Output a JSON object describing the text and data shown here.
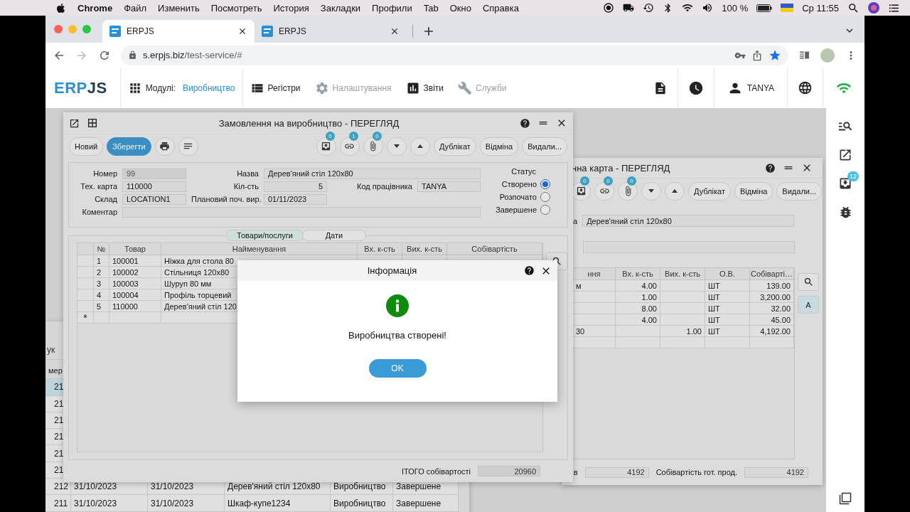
{
  "menubar": {
    "app": "Chrome",
    "menus": [
      "Файл",
      "Изменить",
      "Посмотреть",
      "История",
      "Закладки",
      "Профили",
      "Tab",
      "Окно",
      "Справка"
    ],
    "battery": "100 %",
    "clock": "Ср 11:55"
  },
  "browser": {
    "tabs": [
      {
        "title": "ERPJS",
        "selected": true
      },
      {
        "title": "ERPJS",
        "selected": false
      }
    ],
    "url_host": "s.erpjs.biz",
    "url_path": "/test-service/#"
  },
  "header": {
    "logo": {
      "first": "ERP",
      "second": "JS"
    },
    "modules_label": "Модулі:",
    "module": "Виробництво",
    "nav": [
      {
        "label": "Регістри",
        "kind": "list",
        "disabled": false
      },
      {
        "label": "Налаштування",
        "kind": "gear",
        "disabled": true
      },
      {
        "label": "Звіти",
        "kind": "chart",
        "disabled": false
      },
      {
        "label": "Служби",
        "kind": "wrench",
        "disabled": true
      }
    ],
    "user": "TANYA"
  },
  "sidebar": {
    "inbox_badge": "12"
  },
  "journal": {
    "search_label": "ук",
    "column_1": "мер",
    "rows": [
      {
        "cells": [
          "21"
        ],
        "selected": true
      },
      {
        "cells": [
          "21"
        ],
        "selected": false
      },
      {
        "cells": [
          "21"
        ],
        "selected": false
      },
      {
        "cells": [
          "21"
        ],
        "selected": false
      },
      {
        "cells": [
          "21"
        ],
        "selected": false
      },
      {
        "cells": [
          "21"
        ],
        "selected": false
      },
      {
        "cells": [
          "212",
          "31/10/2023",
          "31/10/2023",
          "Дерев'яний стіл 120x80",
          "Виробництво",
          "Завершене"
        ],
        "selected": false
      },
      {
        "cells": [
          "211",
          "31/10/2023",
          "31/10/2023",
          "Шкаф-купе1234",
          "Виробництво",
          "Завершене"
        ],
        "selected": false
      }
    ]
  },
  "order_window": {
    "title": "Замовлення на виробництво - ПЕРЕГЛЯД",
    "toolbar_left": [
      {
        "kind": "button",
        "label": "Новий",
        "primary": false
      },
      {
        "kind": "button",
        "label": "Зберегти",
        "primary": true
      },
      {
        "kind": "print"
      },
      {
        "kind": "notes"
      }
    ],
    "toolbar_right": [
      {
        "kind": "inbox",
        "badge": "0"
      },
      {
        "kind": "link",
        "badge": "1"
      },
      {
        "kind": "clip",
        "badge": "0"
      },
      {
        "kind": "down"
      },
      {
        "kind": "up"
      },
      {
        "kind": "button",
        "label": "Дублікат",
        "primary": false
      },
      {
        "kind": "button",
        "label": "Відміна",
        "primary": false
      },
      {
        "kind": "button",
        "label": "Видали...",
        "primary": false
      }
    ],
    "fields": {
      "number": {
        "label": "Номер",
        "value": "99",
        "readonly": true
      },
      "name": {
        "label": "Назва",
        "value": "Дерев'яний стіл 120x80",
        "readonly": false
      },
      "tech_card": {
        "label": "Тех. карта",
        "value": "110000",
        "readonly": false
      },
      "quantity": {
        "label": "Кіл-сть",
        "value": "5",
        "readonly": false
      },
      "employee": {
        "label": "Код працівника",
        "value": "TANYA",
        "readonly": false
      },
      "warehouse": {
        "label": "Склад",
        "value": "LOCATION1",
        "readonly": false
      },
      "planned_start": {
        "label": "Плановий поч. вир.",
        "value": "01/11/2023",
        "readonly": false
      },
      "comment": {
        "label": "Коментар"
      }
    },
    "status": {
      "label": "Статус",
      "options": [
        {
          "label": "Створено",
          "selected": true
        },
        {
          "label": "Розпочато",
          "selected": false
        },
        {
          "label": "Завершене",
          "selected": false
        }
      ]
    },
    "tabs": [
      {
        "label": "Товари/послуги",
        "selected": true
      },
      {
        "label": "Дати",
        "selected": false
      }
    ],
    "table": {
      "columns": [
        "№",
        "Товар",
        "Найменування",
        "Вх. к-сть",
        "Вих. к-сть",
        "Собівартість"
      ],
      "rows": [
        {
          "no": "1",
          "code": "100001",
          "name": "Ніжка для стола 80"
        },
        {
          "no": "2",
          "code": "100002",
          "name": "Стільниця 120x80"
        },
        {
          "no": "3",
          "code": "100003",
          "name": "Шуруп 80 мм"
        },
        {
          "no": "4",
          "code": "100004",
          "name": "Профіль торцевий"
        },
        {
          "no": "5",
          "code": "110000",
          "name": "Дерев'яний стіл 120"
        }
      ],
      "new_row_mark": "*"
    },
    "total_label": "ІТОГО собівартості",
    "total": "20960"
  },
  "card_window": {
    "title": "нна карта - ПЕРЕГЛЯД",
    "toolbar": [
      {
        "kind": "inbox",
        "badge": "0"
      },
      {
        "kind": "link",
        "badge": "0"
      },
      {
        "kind": "clip",
        "badge": "0"
      },
      {
        "kind": "down"
      },
      {
        "kind": "up"
      },
      {
        "kind": "button",
        "label": "Дублікат",
        "primary": false
      },
      {
        "kind": "button",
        "label": "Відміна",
        "primary": false
      },
      {
        "kind": "button",
        "label": "Видали...",
        "primary": false
      }
    ],
    "name_label": "а",
    "name_value": "Дерев'яний стіл 120x80",
    "table": {
      "columns": [
        "ння",
        "Вх. к-сть",
        "Вих. к-сть",
        "О.В.",
        "Собіварті…"
      ],
      "rows": [
        {
          "name": "м",
          "qty_in": "4.00",
          "unit": "ШТ",
          "cost": "139.00"
        },
        {
          "qty_in": "1.00",
          "unit": "ШТ",
          "cost": "3,200.00"
        },
        {
          "qty_in": "8.00",
          "unit": "ШТ",
          "cost": "32.00"
        },
        {
          "qty_in": "4.00",
          "unit": "ШТ",
          "cost": "45.00"
        },
        {
          "name": "30",
          "qty_out": "1.00",
          "unit": "ШТ",
          "cost": "4,192.00"
        }
      ]
    },
    "side_buttons": [
      {
        "kind": "search",
        "selected": false
      },
      {
        "kind": "text",
        "label": "A",
        "selected": true
      }
    ],
    "total_label": "в",
    "total": "4192",
    "product_cost_label": "Собівартість гот. прод.",
    "product_cost": "4192"
  },
  "dialog": {
    "title": "Інформація",
    "message": "Виробництва створені!",
    "button": "OK"
  }
}
